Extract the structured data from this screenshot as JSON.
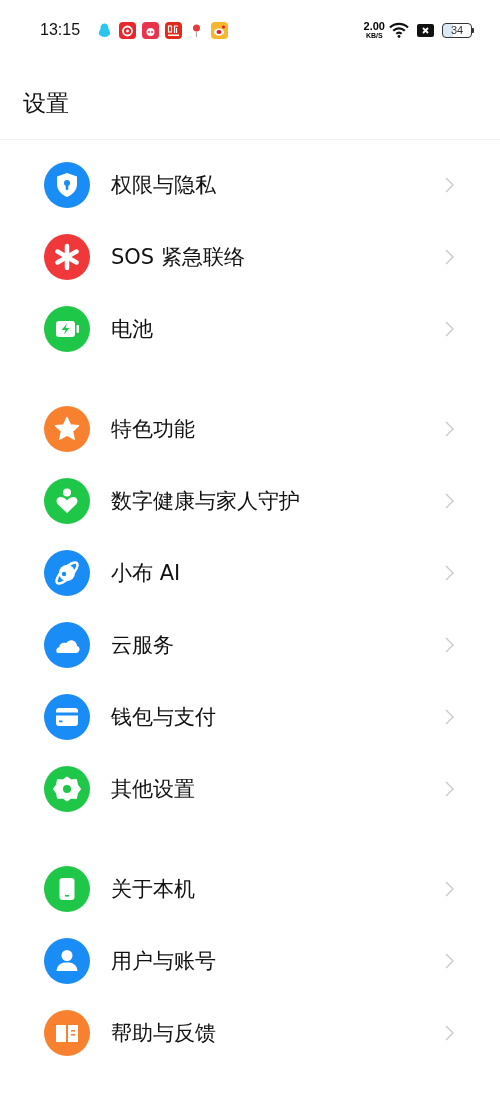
{
  "status_bar": {
    "time": "13:15",
    "net_speed": "2.00",
    "net_unit": "KB/S",
    "battery": "34"
  },
  "title": "设置",
  "groups": [
    {
      "items": [
        {
          "label": "权限与隐私",
          "color": "#1a8cf6"
        },
        {
          "label": "SOS 紧急联络",
          "color": "#f0373a"
        },
        {
          "label": "电池",
          "color": "#1fc749"
        }
      ]
    },
    {
      "items": [
        {
          "label": "特色功能",
          "color": "#f7812e"
        },
        {
          "label": "数字健康与家人守护",
          "color": "#1fc749"
        },
        {
          "label": "小布 AI",
          "color": "#1a8cf6"
        },
        {
          "label": "云服务",
          "color": "#1a8cf6"
        },
        {
          "label": "钱包与支付",
          "color": "#1a8cf6"
        },
        {
          "label": "其他设置",
          "color": "#1fc749"
        }
      ]
    },
    {
      "items": [
        {
          "label": "关于本机",
          "color": "#1fc749"
        },
        {
          "label": "用户与账号",
          "color": "#1a8cf6"
        },
        {
          "label": "帮助与反馈",
          "color": "#f7812e"
        }
      ]
    }
  ]
}
